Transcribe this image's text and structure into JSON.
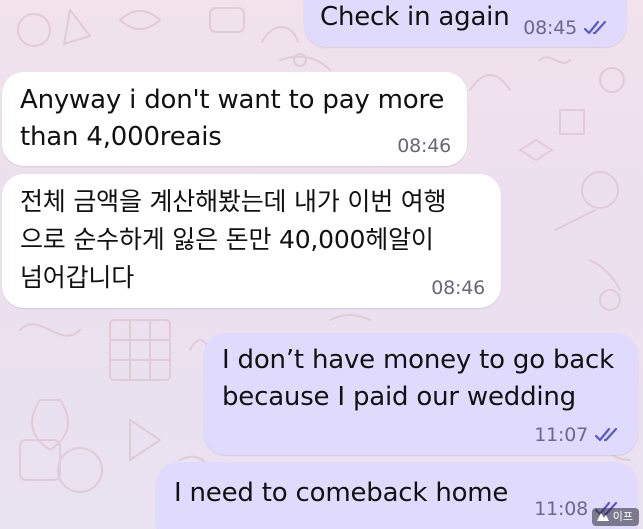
{
  "chat": {
    "messages": [
      {
        "direction": "outgoing",
        "lines": [
          "Check in again"
        ],
        "time": "08:45",
        "status": "read-double-check-icon"
      },
      {
        "direction": "incoming",
        "lines": [
          "Anyway i don't want to pay more",
          "than 4,000reais"
        ],
        "time": "08:46"
      },
      {
        "direction": "incoming",
        "lines": [
          "전체 금액을 계산해봤는데 내가 이번 여행",
          "으로 순수하게 잃은 돈만 40,000헤알이",
          "넘어갑니다"
        ],
        "time": "08:46"
      },
      {
        "direction": "outgoing",
        "lines": [
          "I don’t have money to go back",
          "because I paid our wedding"
        ],
        "time": "11:07",
        "status": "read-double-check-icon"
      },
      {
        "direction": "outgoing",
        "lines": [
          "I need to comeback home"
        ],
        "time": "11:08",
        "status": "read-double-check-icon"
      }
    ]
  },
  "colors": {
    "incoming_bubble": "#ffffff",
    "outgoing_bubble": "#e0dbfc",
    "read_ticks": "#5b58c9",
    "background": "#ece2ef"
  },
  "watermark": {
    "text": "이프",
    "icon": "site-logo-icon"
  }
}
